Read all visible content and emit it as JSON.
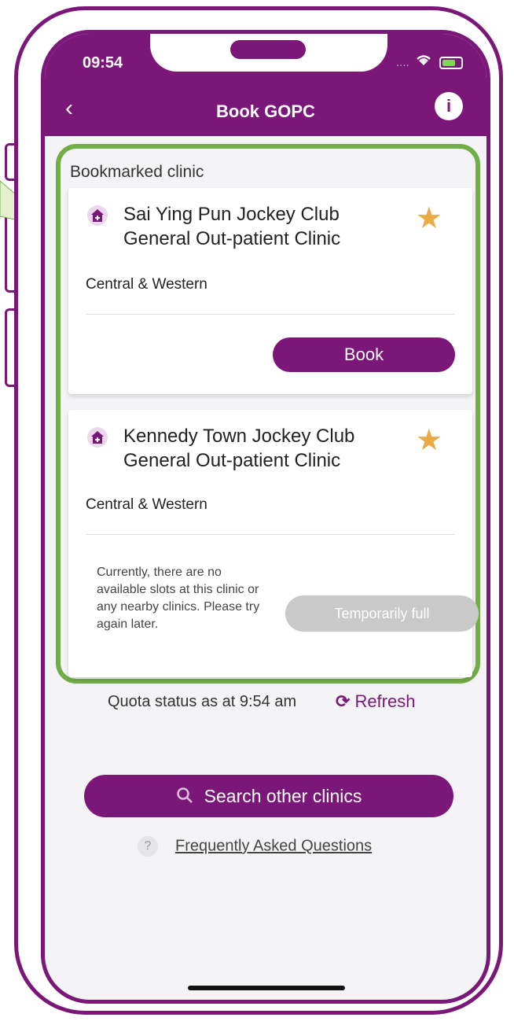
{
  "status_bar": {
    "time": "09:54",
    "dots": "....",
    "wifi_icon": "wifi-icon",
    "battery_icon": "battery-icon"
  },
  "header": {
    "back_icon": "‹",
    "title": "Book GOPC",
    "info_icon": "i"
  },
  "bookmarked": {
    "label": "Bookmarked clinic",
    "clinics": [
      {
        "name": "Sai Ying Pun Jockey Club General Out-patient Clinic",
        "district": "Central & Western",
        "action_label": "Book"
      },
      {
        "name": "Kennedy Town Jockey Club General Out-patient Clinic",
        "district": "Central & Western",
        "message": "Currently, there are no available slots at this clinic or any nearby clinics. Please try again later.",
        "action_label": "Temporarily full"
      }
    ]
  },
  "quota": {
    "status": "Quota status as at 9:54 am",
    "refresh_label": "Refresh"
  },
  "search_button": {
    "label": "Search other clinics"
  },
  "faq": {
    "icon": "?",
    "label": "Frequently Asked Questions"
  },
  "colors": {
    "brand": "#7b1778",
    "highlight_border": "#71ae47",
    "star": "#ebaa45",
    "disabled": "#c9c9c9"
  }
}
